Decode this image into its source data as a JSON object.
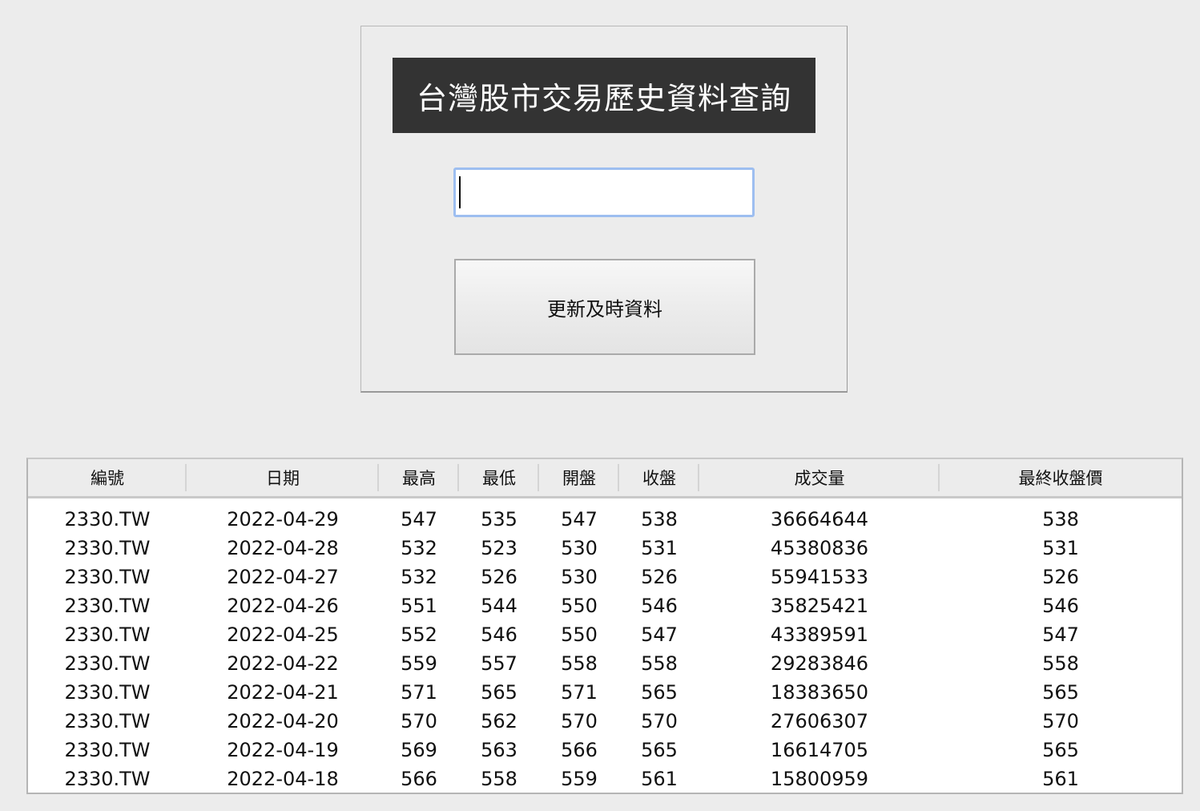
{
  "header": {
    "title": "台灣股市交易歷史資料查詢"
  },
  "search": {
    "value": "",
    "placeholder": ""
  },
  "refresh_button": {
    "label": "更新及時資料"
  },
  "table": {
    "columns": [
      "編號",
      "日期",
      "最高",
      "最低",
      "開盤",
      "收盤",
      "成交量",
      "最終收盤價"
    ],
    "rows": [
      [
        "2330.TW",
        "2022-04-29",
        "547",
        "535",
        "547",
        "538",
        "36664644",
        "538"
      ],
      [
        "2330.TW",
        "2022-04-28",
        "532",
        "523",
        "530",
        "531",
        "45380836",
        "531"
      ],
      [
        "2330.TW",
        "2022-04-27",
        "532",
        "526",
        "530",
        "526",
        "55941533",
        "526"
      ],
      [
        "2330.TW",
        "2022-04-26",
        "551",
        "544",
        "550",
        "546",
        "35825421",
        "546"
      ],
      [
        "2330.TW",
        "2022-04-25",
        "552",
        "546",
        "550",
        "547",
        "43389591",
        "547"
      ],
      [
        "2330.TW",
        "2022-04-22",
        "559",
        "557",
        "558",
        "558",
        "29283846",
        "558"
      ],
      [
        "2330.TW",
        "2022-04-21",
        "571",
        "565",
        "571",
        "565",
        "18383650",
        "565"
      ],
      [
        "2330.TW",
        "2022-04-20",
        "570",
        "562",
        "570",
        "570",
        "27606307",
        "570"
      ],
      [
        "2330.TW",
        "2022-04-19",
        "569",
        "563",
        "566",
        "565",
        "16614705",
        "565"
      ],
      [
        "2330.TW",
        "2022-04-18",
        "566",
        "558",
        "559",
        "561",
        "15800959",
        "561"
      ]
    ]
  }
}
